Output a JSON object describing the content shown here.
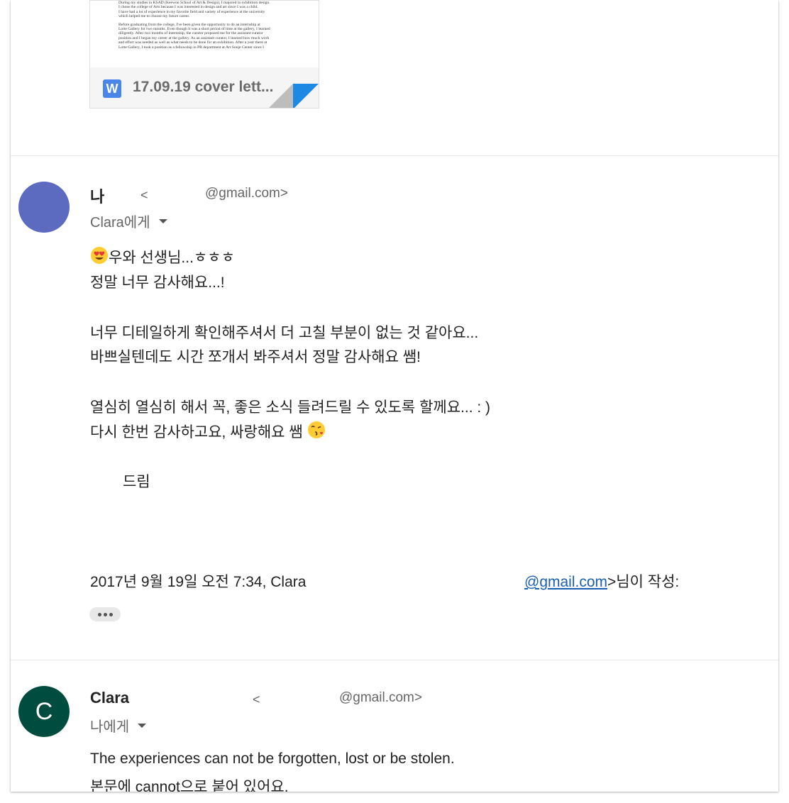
{
  "attachment": {
    "icon_letter": "W",
    "filename": "17.09.19 cover lett...",
    "preview_lines": [
      "During my studies in KSAD (Keewon School of Art & Design), I majored in exhibition design.",
      "I chose the college of Arts because I was interested in design and art since I was a child.",
      "I have had a lot of experience in my favorite field and variety of experience at the university",
      "which helped me to choose my future career.",
      "Before graduating from the college, I've been given the opportunity to do an internship at",
      "Lotte Gallery for two months.   Even though it was a short period of time at the gallery, I learned",
      "diligently.  After two months of internship, the curator proposed me for the assistant curator",
      "position and I began my career at the gallery.  As an assistant curator, I learned how much work",
      "and effort was needed as well as what needs to be done for an exhibition.  After a year there at",
      "Lotte Gallery, I took a position as a fellowship in PR department at Art Sonje Center since I"
    ]
  },
  "message1": {
    "avatar_color": "#5c6bc0",
    "sender": "나",
    "lt": "<",
    "email": "@gmail.com>",
    "recipient": "Clara에게",
    "lines": [
      "우와 선생님...ㅎㅎㅎ",
      "정말 너무 감사해요...!",
      "너무 디테일하게 확인해주셔서 더 고칠 부분이 없는 것 같아요...",
      "바쁘실텐데도 시간 쪼개서 봐주셔서 정말 감사해요 쌤!",
      "열심히 열심히 해서 꼭, 좋은 소식 들려드릴 수 있도록 할께요... : )",
      "다시 한번 감사하고요, 싸랑해요 쌤",
      "드림"
    ],
    "emoji_start": "heart-eyes",
    "emoji_end": "kissing-face",
    "quote_header": "2017년 9월 19일 오전 7:34, Clara",
    "quote_link": "@gmail.com",
    "quote_suffix": ">님이 작성:"
  },
  "message2": {
    "avatar_color": "#004d40",
    "avatar_letter": "C",
    "sender": "Clara",
    "lt": "<",
    "email": "@gmail.com>",
    "recipient": "나에게",
    "lines": [
      "The experiences can not be forgotten, lost or be stolen.",
      "본문에 cannot으로 붙어 있어요."
    ]
  }
}
